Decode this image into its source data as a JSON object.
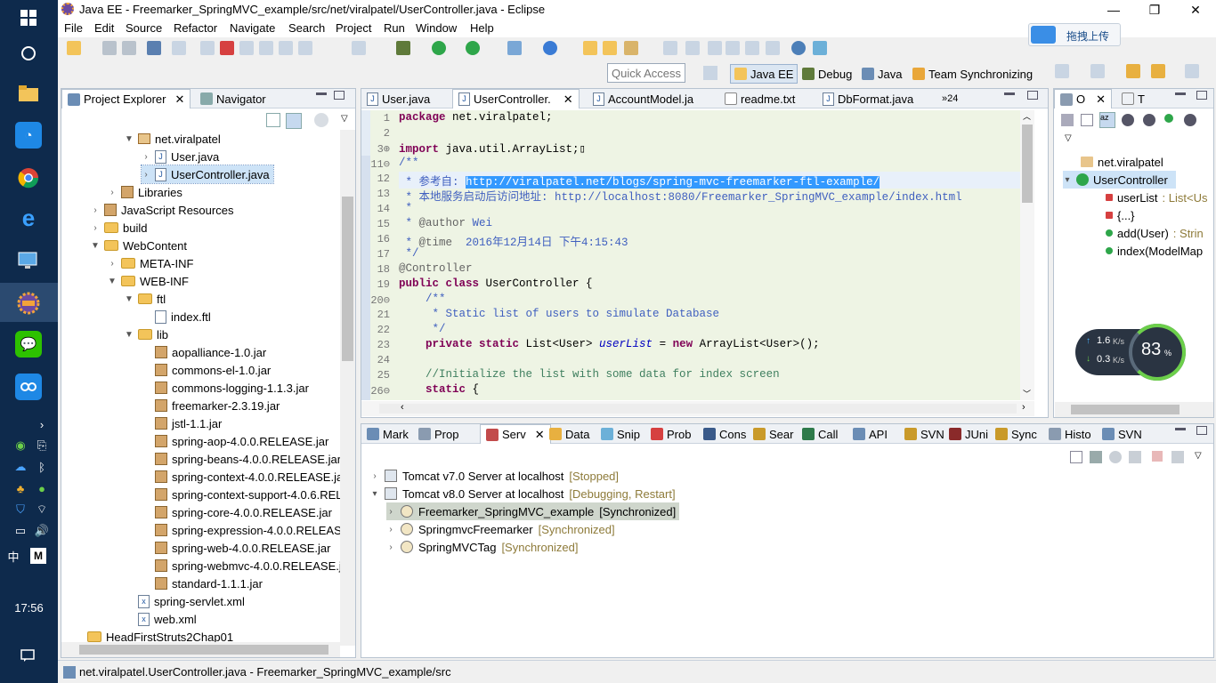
{
  "taskbar": {
    "clock": "17:56",
    "ime_lang": "中",
    "ime_mode": "M"
  },
  "window": {
    "title": "Java EE - Freemarker_SpringMVC_example/src/net/viralpatel/UserController.java - Eclipse",
    "minimize": "—",
    "maximize": "❐",
    "close": "✕"
  },
  "menu": [
    "File",
    "Edit",
    "Source",
    "Refactor",
    "Navigate",
    "Search",
    "Project",
    "Run",
    "Window",
    "Help"
  ],
  "cloud_upload": "拖拽上传",
  "quick_access": "Quick Access",
  "perspectives": [
    "Java EE",
    "Debug",
    "Java",
    "Team Synchronizing"
  ],
  "left_panel": {
    "tabs": [
      "Project Explorer",
      "Navigator"
    ],
    "tree": [
      {
        "label": "net.viralpatel",
        "type": "pkg",
        "depth": 3,
        "arrow": "▼"
      },
      {
        "label": "User.java",
        "type": "java",
        "depth": 4,
        "arrow": "›"
      },
      {
        "label": "UserController.java",
        "type": "java",
        "depth": 4,
        "arrow": "›",
        "selected": true
      },
      {
        "label": "Libraries",
        "type": "lib",
        "depth": 2,
        "arrow": "›"
      },
      {
        "label": "JavaScript Resources",
        "type": "lib",
        "depth": 1,
        "arrow": "›"
      },
      {
        "label": "build",
        "type": "folder",
        "depth": 1,
        "arrow": "›"
      },
      {
        "label": "WebContent",
        "type": "folder",
        "depth": 1,
        "arrow": "▼"
      },
      {
        "label": "META-INF",
        "type": "folder",
        "depth": 2,
        "arrow": "›"
      },
      {
        "label": "WEB-INF",
        "type": "folder",
        "depth": 2,
        "arrow": "▼"
      },
      {
        "label": "ftl",
        "type": "folder",
        "depth": 3,
        "arrow": "▼"
      },
      {
        "label": "index.ftl",
        "type": "file",
        "depth": 4,
        "arrow": ""
      },
      {
        "label": "lib",
        "type": "folder",
        "depth": 3,
        "arrow": "▼"
      },
      {
        "label": "aopalliance-1.0.jar",
        "type": "jar",
        "depth": 4,
        "arrow": ""
      },
      {
        "label": "commons-el-1.0.jar",
        "type": "jar",
        "depth": 4,
        "arrow": ""
      },
      {
        "label": "commons-logging-1.1.3.jar",
        "type": "jar",
        "depth": 4,
        "arrow": ""
      },
      {
        "label": "freemarker-2.3.19.jar",
        "type": "jar",
        "depth": 4,
        "arrow": ""
      },
      {
        "label": "jstl-1.1.jar",
        "type": "jar",
        "depth": 4,
        "arrow": ""
      },
      {
        "label": "spring-aop-4.0.0.RELEASE.jar",
        "type": "jar",
        "depth": 4,
        "arrow": ""
      },
      {
        "label": "spring-beans-4.0.0.RELEASE.jar",
        "type": "jar",
        "depth": 4,
        "arrow": ""
      },
      {
        "label": "spring-context-4.0.0.RELEASE.jar",
        "type": "jar",
        "depth": 4,
        "arrow": ""
      },
      {
        "label": "spring-context-support-4.0.6.REL",
        "type": "jar",
        "depth": 4,
        "arrow": ""
      },
      {
        "label": "spring-core-4.0.0.RELEASE.jar",
        "type": "jar",
        "depth": 4,
        "arrow": ""
      },
      {
        "label": "spring-expression-4.0.0.RELEASE.",
        "type": "jar",
        "depth": 4,
        "arrow": ""
      },
      {
        "label": "spring-web-4.0.0.RELEASE.jar",
        "type": "jar",
        "depth": 4,
        "arrow": ""
      },
      {
        "label": "spring-webmvc-4.0.0.RELEASE.jar",
        "type": "jar",
        "depth": 4,
        "arrow": ""
      },
      {
        "label": "standard-1.1.1.jar",
        "type": "jar",
        "depth": 4,
        "arrow": ""
      },
      {
        "label": "spring-servlet.xml",
        "type": "xml",
        "depth": 3,
        "arrow": ""
      },
      {
        "label": "web.xml",
        "type": "xml",
        "depth": 3,
        "arrow": ""
      },
      {
        "label": "HeadFirstStruts2Chap01",
        "type": "project",
        "depth": 0,
        "arrow": ""
      }
    ]
  },
  "editor": {
    "tabs": [
      "User.java",
      "UserController.",
      "AccountModel.ja",
      "readme.txt",
      "DbFormat.java"
    ],
    "overflow": "»24",
    "lines": [
      {
        "n": "1",
        "segs": [
          {
            "c": "kw",
            "t": "package"
          },
          {
            "c": "",
            "t": " net.viralpatel;"
          }
        ]
      },
      {
        "n": "2",
        "segs": []
      },
      {
        "n": "3⊕",
        "segs": [
          {
            "c": "kw",
            "t": "import"
          },
          {
            "c": "",
            "t": " java.util.ArrayList;▯"
          }
        ]
      },
      {
        "n": "11⊖",
        "segs": [
          {
            "c": "cm",
            "t": "/**"
          }
        ]
      },
      {
        "n": "12",
        "segs": [
          {
            "c": "cm",
            "t": " * 参考自: "
          },
          {
            "c": "cm hl",
            "t": "http://viralpatel.net/blogs/spring-mvc-freemarker-ftl-example/"
          }
        ]
      },
      {
        "n": "13",
        "segs": [
          {
            "c": "cm",
            "t": " * 本地服务启动后访问地址: http://localhost:8080/Freemarker_SpringMVC_example/index.html"
          }
        ]
      },
      {
        "n": "14",
        "segs": [
          {
            "c": "cm",
            "t": " *"
          }
        ]
      },
      {
        "n": "15",
        "segs": [
          {
            "c": "cm",
            "t": " * "
          },
          {
            "c": "an",
            "t": "@author"
          },
          {
            "c": "cm",
            "t": " Wei"
          }
        ]
      },
      {
        "n": "16",
        "segs": [
          {
            "c": "cm",
            "t": " * "
          },
          {
            "c": "an",
            "t": "@time"
          },
          {
            "c": "cm",
            "t": "  2016年12月14日 下午4:15:43"
          }
        ]
      },
      {
        "n": "17",
        "segs": [
          {
            "c": "cm",
            "t": " */"
          }
        ]
      },
      {
        "n": "18",
        "segs": [
          {
            "c": "an",
            "t": "@Controller"
          }
        ]
      },
      {
        "n": "19",
        "segs": [
          {
            "c": "kw",
            "t": "public class"
          },
          {
            "c": "",
            "t": " UserController {"
          }
        ]
      },
      {
        "n": "20⊖",
        "segs": [
          {
            "c": "cm",
            "t": "    /**"
          }
        ]
      },
      {
        "n": "21",
        "segs": [
          {
            "c": "cm",
            "t": "     * Static list of users to simulate Database"
          }
        ]
      },
      {
        "n": "22",
        "segs": [
          {
            "c": "cm",
            "t": "     */"
          }
        ]
      },
      {
        "n": "23",
        "segs": [
          {
            "c": "kw",
            "t": "    private static"
          },
          {
            "c": "",
            "t": " List<User> "
          },
          {
            "c": "fld",
            "t": "userList"
          },
          {
            "c": "",
            "t": " = "
          },
          {
            "c": "kw",
            "t": "new"
          },
          {
            "c": "",
            "t": " ArrayList<User>();"
          }
        ]
      },
      {
        "n": "24",
        "segs": []
      },
      {
        "n": "25",
        "segs": [
          {
            "c": "cm2",
            "t": "    //Initialize the list with some data for index screen"
          }
        ]
      },
      {
        "n": "26⊖",
        "segs": [
          {
            "c": "kw",
            "t": "    static"
          },
          {
            "c": "",
            "t": " {"
          }
        ]
      }
    ]
  },
  "outline": {
    "tabs": [
      "O",
      "T"
    ],
    "items": [
      {
        "label": "net.viralpatel",
        "detail": "",
        "type": "pkg"
      },
      {
        "label": "UserController",
        "detail": "",
        "type": "class"
      },
      {
        "label": "userList",
        "detail": " : List<Us",
        "type": "field"
      },
      {
        "label": "{...}",
        "detail": "",
        "type": "static"
      },
      {
        "label": "add(User)",
        "detail": " : Strin",
        "type": "method"
      },
      {
        "label": "index(ModelMap",
        "detail": "",
        "type": "method"
      }
    ]
  },
  "net_widget": {
    "up": "1.6",
    "up_unit": "K/s",
    "down": "0.3",
    "down_unit": "K/s",
    "percent": "83",
    "percent_unit": "%"
  },
  "bottom_panel": {
    "tabs": [
      "Mark",
      "Prop",
      "Serv",
      "Data",
      "Snip",
      "Prob",
      "Cons",
      "Sear",
      "Call",
      "API",
      "SVN",
      "JUni",
      "Sync",
      "Histo",
      "SVN"
    ],
    "servers": [
      {
        "label": "Tomcat v7.0 Server at localhost",
        "state": "[Stopped]",
        "depth": 0,
        "arrow": "›"
      },
      {
        "label": "Tomcat v8.0 Server at localhost",
        "state": "[Debugging, Restart]",
        "depth": 0,
        "arrow": "▾"
      },
      {
        "label": "Freemarker_SpringMVC_example",
        "state": "[Synchronized]",
        "depth": 1,
        "arrow": "›",
        "selected": true
      },
      {
        "label": "SpringmvcFreemarker",
        "state": "[Synchronized]",
        "depth": 1,
        "arrow": "›"
      },
      {
        "label": "SpringMVCTag",
        "state": "[Synchronized]",
        "depth": 1,
        "arrow": "›"
      }
    ]
  },
  "status": "net.viralpatel.UserController.java - Freemarker_SpringMVC_example/src"
}
